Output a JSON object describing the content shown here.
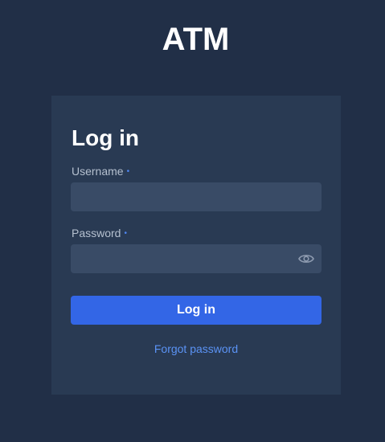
{
  "app": {
    "title": "ATM"
  },
  "login_form": {
    "heading": "Log in",
    "username": {
      "label": "Username",
      "required_marker": "•",
      "value": "",
      "placeholder": ""
    },
    "password": {
      "label": "Password",
      "required_marker": "•",
      "value": "",
      "placeholder": "",
      "toggle_icon": "eye-icon"
    },
    "submit_label": "Log in",
    "forgot_password_label": "Forgot password"
  },
  "colors": {
    "page_background": "#212f47",
    "card_background": "#293a53",
    "input_background": "#394b66",
    "primary_button": "#3366e6",
    "link": "#5b93f5",
    "required_marker": "#4f86f2"
  }
}
